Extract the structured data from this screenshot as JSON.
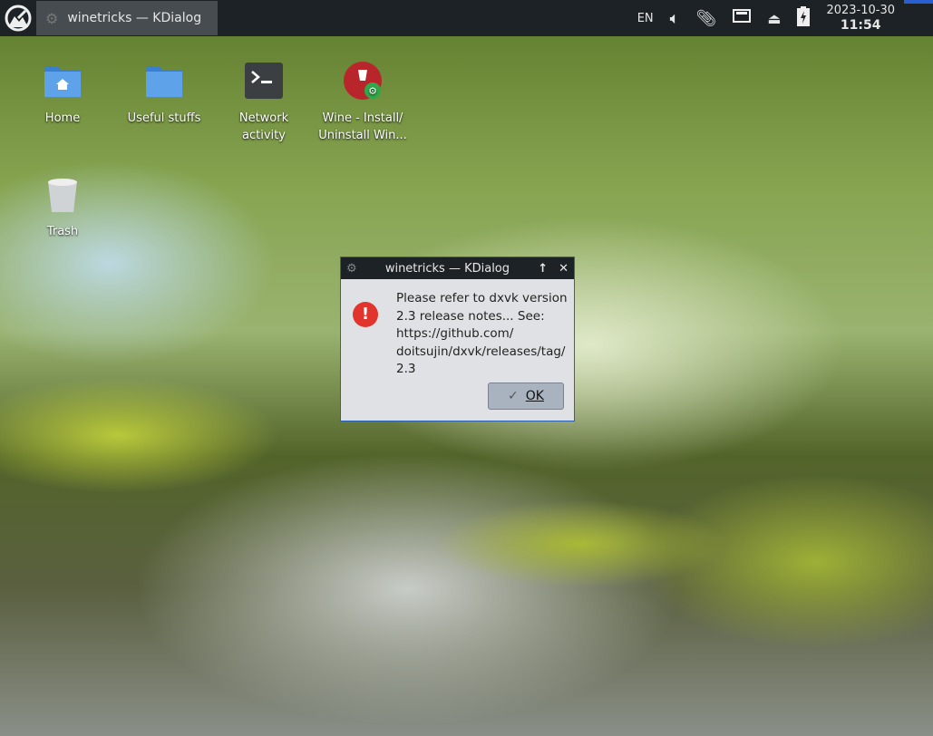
{
  "panel": {
    "task_title": "winetricks — KDialog",
    "lang": "EN",
    "date": "2023-10-30",
    "time": "11:54"
  },
  "desktop": [
    {
      "label": "Home"
    },
    {
      "label": "Useful stuffs"
    },
    {
      "label": "Network activity"
    },
    {
      "label": "Wine - Install/ Uninstall Win..."
    },
    {
      "label": "Trash"
    }
  ],
  "dialog": {
    "title": "winetricks — KDialog",
    "message": [
      "Please refer to dxvk version",
      "2.3 release notes... See:",
      "https://github.com/",
      "doitsujin/dxvk/releases/tag/",
      "2.3"
    ],
    "ok_label": "OK"
  }
}
